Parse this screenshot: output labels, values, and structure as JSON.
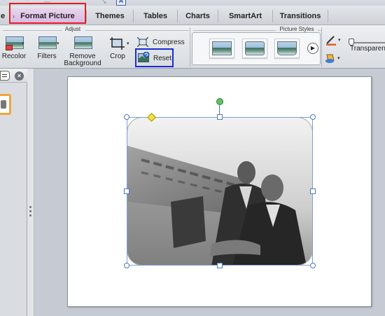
{
  "tabs": [
    {
      "label": "e"
    },
    {
      "label": "Format Picture"
    },
    {
      "label": "Themes"
    },
    {
      "label": "Tables"
    },
    {
      "label": "Charts"
    },
    {
      "label": "SmartArt"
    },
    {
      "label": "Transitions"
    }
  ],
  "toolbar_glyph": "A",
  "ribbon": {
    "adjust_group": {
      "label": "Adjust",
      "recolor": "Recolor",
      "filters": "Filters",
      "remove_background_line1": "Remove",
      "remove_background_line2": "Background",
      "crop": "Crop",
      "compress": "Compress",
      "reset": "Reset"
    },
    "picture_styles_group": {
      "label": "Picture Styles"
    },
    "transparency": "Transparen"
  },
  "highlights": {
    "format_picture_box_color": "#e11c24",
    "reset_box_color": "#1a2bd6"
  },
  "left_panel": {
    "close_glyph": "×"
  }
}
